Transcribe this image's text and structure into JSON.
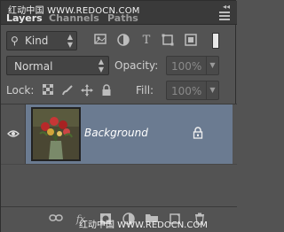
{
  "watermark": {
    "top": "红动中国 WWW.REDOCN.COM",
    "bottom": "红动中国 WWW.REDOCN.COM"
  },
  "tabs": [
    {
      "label": "Layers",
      "active": true
    },
    {
      "label": "Channels",
      "active": false
    },
    {
      "label": "Paths",
      "active": false
    }
  ],
  "filter": {
    "kind_label": "Kind",
    "icons": [
      "image-filter-icon",
      "adjustment-filter-icon",
      "type-filter-icon",
      "shape-filter-icon",
      "smart-object-filter-icon"
    ]
  },
  "blend": {
    "mode": "Normal",
    "opacity_label": "Opacity:",
    "opacity_value": "100%"
  },
  "lock": {
    "label": "Lock:",
    "icons": [
      "lock-transparent-icon",
      "lock-image-icon",
      "lock-position-icon",
      "lock-all-icon"
    ],
    "fill_label": "Fill:",
    "fill_value": "100%"
  },
  "layers": [
    {
      "name": "Background",
      "visible": true,
      "locked": true,
      "selected": true
    }
  ],
  "bottom_toolbar": [
    "link-layers-icon",
    "fx-icon",
    "add-mask-icon",
    "adjustment-layer-icon",
    "new-group-icon",
    "new-layer-icon",
    "trash-icon"
  ],
  "colors": {
    "panel": "#535353",
    "selected_row": "#6b7b91",
    "top_strip": "#3a3a3a"
  }
}
